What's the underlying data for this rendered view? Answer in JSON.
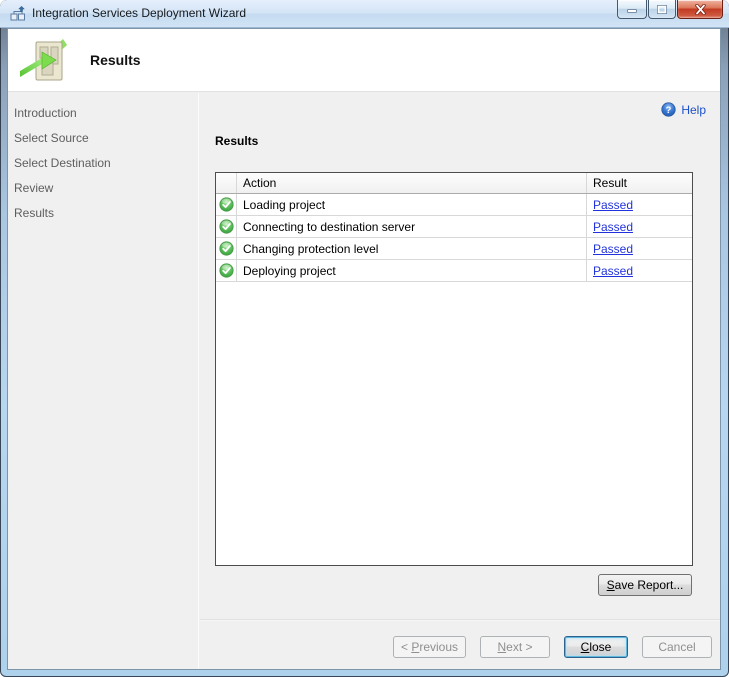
{
  "window": {
    "title": "Integration Services Deployment Wizard"
  },
  "header": {
    "title": "Results"
  },
  "sidebar": {
    "items": [
      "Introduction",
      "Select Source",
      "Select Destination",
      "Review",
      "Results"
    ]
  },
  "main": {
    "help_label": "Help",
    "help_icon_glyph": "?",
    "section_title": "Results",
    "table": {
      "columns": {
        "action": "Action",
        "result": "Result"
      },
      "rows": [
        {
          "icon": "success-check",
          "action": "Loading project",
          "result": "Passed"
        },
        {
          "icon": "success-check",
          "action": "Connecting to destination server",
          "result": "Passed"
        },
        {
          "icon": "success-check",
          "action": "Changing protection level",
          "result": "Passed"
        },
        {
          "icon": "success-check",
          "action": "Deploying project",
          "result": "Passed"
        }
      ]
    },
    "save_report_button": {
      "accel": "S",
      "post": "ave Report..."
    }
  },
  "footer": {
    "previous_button": {
      "pre": "< ",
      "accel": "P",
      "post": "revious",
      "enabled": false
    },
    "next_button": {
      "accel": "N",
      "post": "ext >",
      "enabled": false
    },
    "close_button": {
      "accel": "C",
      "post": "lose",
      "enabled": true,
      "is_default": true
    },
    "cancel_button": {
      "label": "Cancel",
      "enabled": false
    }
  },
  "colors": {
    "success_green": "#46b44b",
    "link_blue": "#2233dd",
    "help_link_blue": "#1d50c8",
    "titlebar_blue": "#d3e4f6",
    "close_caption_red": "#c23a22",
    "default_button_focus_blue": "#2c628b"
  }
}
